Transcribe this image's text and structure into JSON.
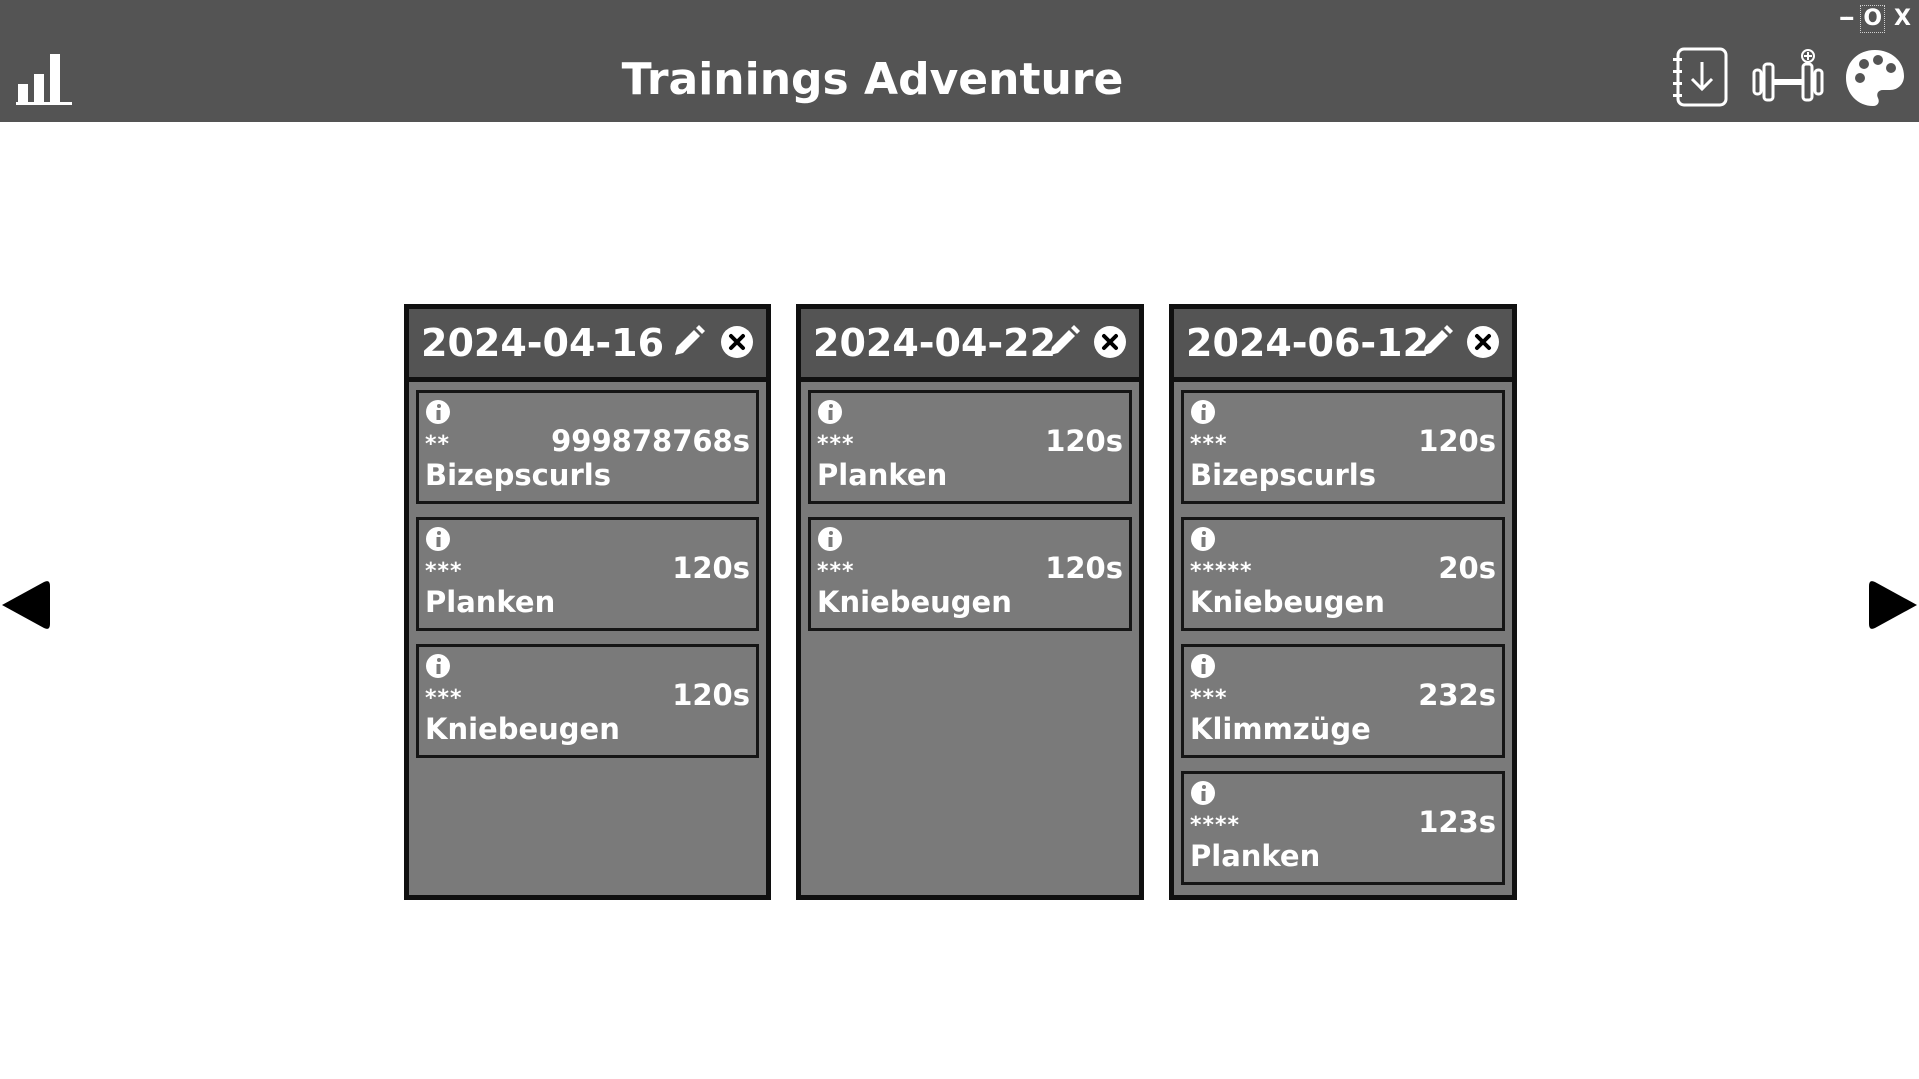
{
  "app": {
    "title": "Trainings Adventure",
    "window_controls": {
      "minimize": "--",
      "maximize": "O",
      "close": "X"
    }
  },
  "toolbar": {
    "left_icon": "bar-chart-icon",
    "right_icons": [
      "import-icon",
      "add-exercise-dumbbell-icon",
      "palette-icon"
    ]
  },
  "navigation": {
    "prev": "triangle-left-icon",
    "next": "triangle-right-icon"
  },
  "days": [
    {
      "date": "2024-04-16",
      "exercises": [
        {
          "stars": "**",
          "name": "Bizepscurls",
          "time": "999878768s"
        },
        {
          "stars": "***",
          "name": "Planken",
          "time": "120s"
        },
        {
          "stars": "***",
          "name": "Kniebeugen",
          "time": "120s"
        }
      ]
    },
    {
      "date": "2024-04-22",
      "exercises": [
        {
          "stars": "***",
          "name": "Planken",
          "time": "120s"
        },
        {
          "stars": "***",
          "name": "Kniebeugen",
          "time": "120s"
        }
      ]
    },
    {
      "date": "2024-06-12",
      "exercises": [
        {
          "stars": "***",
          "name": "Bizepscurls",
          "time": "120s"
        },
        {
          "stars": "*****",
          "name": "Kniebeugen",
          "time": "20s"
        },
        {
          "stars": "***",
          "name": "Klimmzüge",
          "time": "232s"
        },
        {
          "stars": "****",
          "name": "Planken",
          "time": "123s"
        }
      ]
    }
  ],
  "colors": {
    "topbar": "#545454",
    "card_bg": "#7a7a7a",
    "card_border": "#101010",
    "text": "#ffffff",
    "page_bg": "#ffffff"
  }
}
